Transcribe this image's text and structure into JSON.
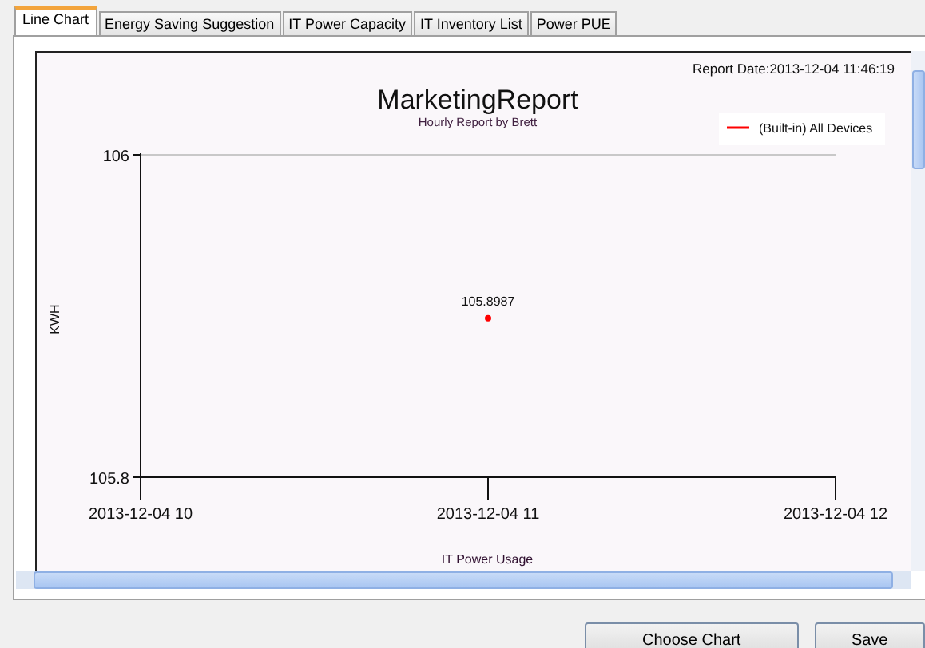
{
  "tabs": [
    {
      "label": "Line Chart",
      "selected": true
    },
    {
      "label": "Energy Saving Suggestion",
      "selected": false
    },
    {
      "label": "IT Power Capacity",
      "selected": false
    },
    {
      "label": "IT Inventory List",
      "selected": false
    },
    {
      "label": "Power PUE",
      "selected": false
    }
  ],
  "report_date": "Report Date:2013-12-04 11:46:19",
  "chart_data": {
    "type": "line",
    "title": "MarketingReport",
    "subtitle": "Hourly Report by Brett",
    "xlabel": "IT Power Usage",
    "ylabel": "KWH",
    "categories": [
      "2013-12-04 10",
      "2013-12-04 11",
      "2013-12-04 12"
    ],
    "ylim": [
      105.8,
      106
    ],
    "yticks": [
      {
        "value": 105.8,
        "label": "105.8"
      },
      {
        "value": 106,
        "label": "106"
      }
    ],
    "data_labels": true,
    "series": [
      {
        "name": "(Built-in) All Devices",
        "color": "#ff0000",
        "marker": "circle",
        "values": [
          null,
          105.8987,
          null
        ],
        "value_labels": [
          null,
          "105.8987",
          null
        ]
      }
    ]
  },
  "buttons": [
    "Choose Chart",
    "Save"
  ]
}
